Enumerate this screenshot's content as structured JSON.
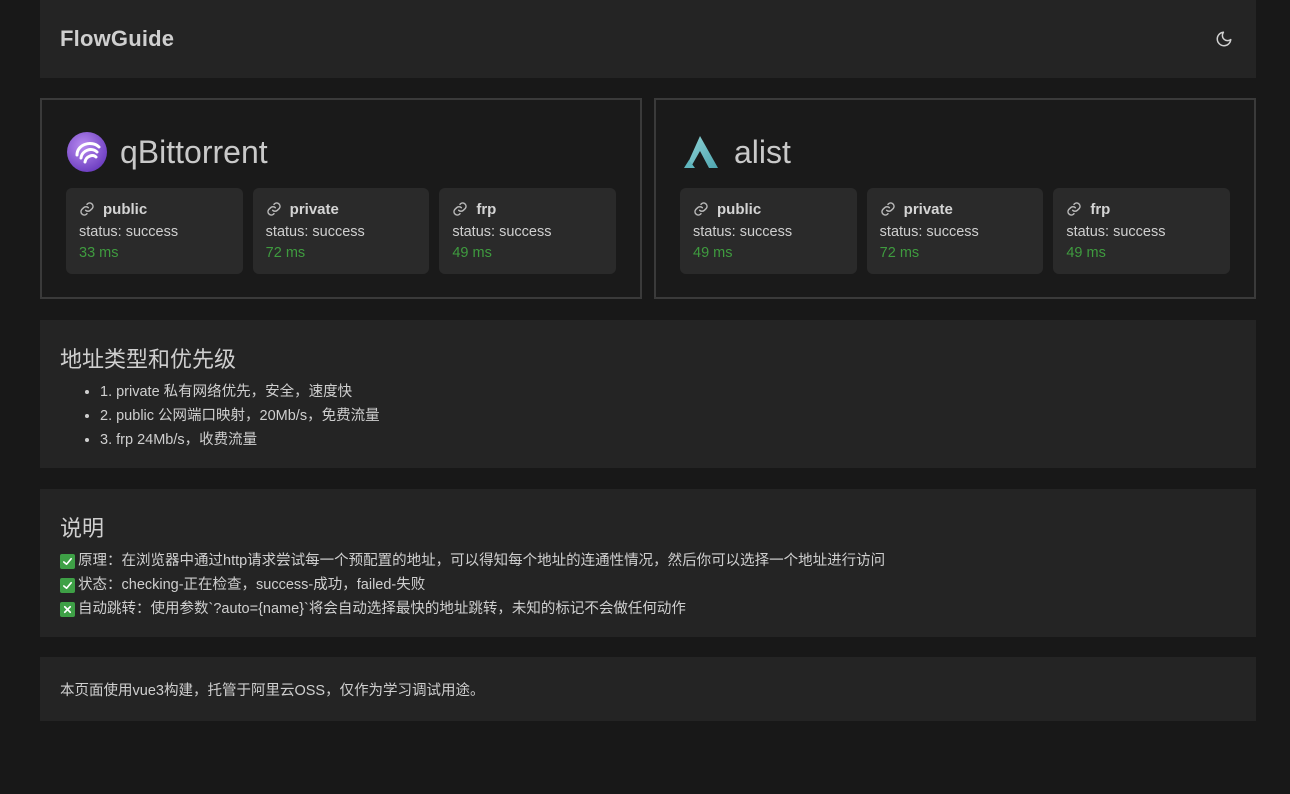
{
  "header": {
    "brand": "FlowGuide",
    "theme_icon": "moon-icon"
  },
  "apps": [
    {
      "name": "qBittorrent",
      "logo": "qbittorrent-logo",
      "links": [
        {
          "label": "public",
          "status": "status: success",
          "latency": "33 ms"
        },
        {
          "label": "private",
          "status": "status: success",
          "latency": "72 ms"
        },
        {
          "label": "frp",
          "status": "status: success",
          "latency": "49 ms"
        }
      ]
    },
    {
      "name": "alist",
      "logo": "alist-logo",
      "links": [
        {
          "label": "public",
          "status": "status: success",
          "latency": "49 ms"
        },
        {
          "label": "private",
          "status": "status: success",
          "latency": "72 ms"
        },
        {
          "label": "frp",
          "status": "status: success",
          "latency": "49 ms"
        }
      ]
    }
  ],
  "priority": {
    "title": "地址类型和优先级",
    "items": [
      "1. private 私有网络优先，安全，速度快",
      "2. public 公网端口映射，20Mb/s，免费流量",
      "3. frp 24Mb/s，收费流量"
    ]
  },
  "description": {
    "title": "说明",
    "items": [
      {
        "icon": "check-mark-icon",
        "text": "原理：在浏览器中通过http请求尝试每一个预配置的地址，可以得知每个地址的连通性情况，然后你可以选择一个地址进行访问"
      },
      {
        "icon": "check-mark-icon",
        "text": "状态：checking-正在检查，success-成功，failed-失败"
      },
      {
        "icon": "cross-mark-icon",
        "text": "自动跳转：使用参数`?auto={name}`将会自动选择最快的地址跳转，未知的标记不会做任何动作"
      }
    ]
  },
  "footer": {
    "text": "本页面使用vue3构建，托管于阿里云OSS，仅作为学习调试用途。"
  },
  "colors": {
    "success": "#3f9b3f",
    "check_bg": "#3ea046"
  }
}
